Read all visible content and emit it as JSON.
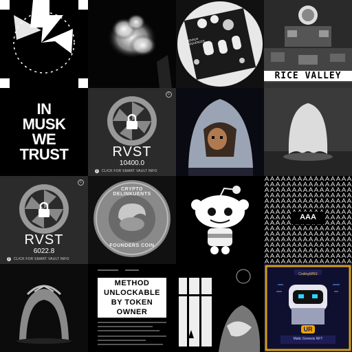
{
  "gallery": {
    "tiles": [
      {
        "name": "tile-lightning-logo"
      },
      {
        "name": "tile-smoke"
      },
      {
        "name": "tile-synth",
        "text": "SENSOR SEQUENCER"
      },
      {
        "name": "tile-rice-valley",
        "text": "RICE VALLEY"
      },
      {
        "name": "tile-in-musk",
        "lines": [
          "IN",
          "MUSK",
          "WE",
          "TRUST"
        ]
      },
      {
        "name": "tile-rvst-1",
        "title": "RVST",
        "value": "10400.0",
        "info": "CLICK FOR SMART VAULT INFO",
        "badge": "C"
      },
      {
        "name": "tile-hooded-pixel"
      },
      {
        "name": "tile-ghost"
      },
      {
        "name": "tile-rvst-2",
        "title": "RVST",
        "value": "6022.8",
        "info": "CLICK FOR SMART VAULT INFO",
        "badge": "C"
      },
      {
        "name": "tile-coin",
        "top_text": "CRYPTO DELINKUENTS",
        "bottom_text": "FOUNDERS COIN"
      },
      {
        "name": "tile-reddit-alien"
      },
      {
        "name": "tile-aaa",
        "text": "AAA"
      },
      {
        "name": "tile-arch"
      },
      {
        "name": "tile-method",
        "lines": [
          "METHOD",
          "UNLOCKABLE",
          "BY TOKEN",
          "OWNER"
        ]
      },
      {
        "name": "tile-window-art"
      },
      {
        "name": "tile-coding-nft",
        "header": "CodingWNS",
        "badge": "UR",
        "caption": "Matic Genesis NFT"
      }
    ]
  },
  "colors": {
    "background": "#000000",
    "vault_bg": "#2b2b2b",
    "coding_bg": "#0f1030",
    "coding_border": "#d4a017",
    "ur_badge": "#f0a500"
  }
}
